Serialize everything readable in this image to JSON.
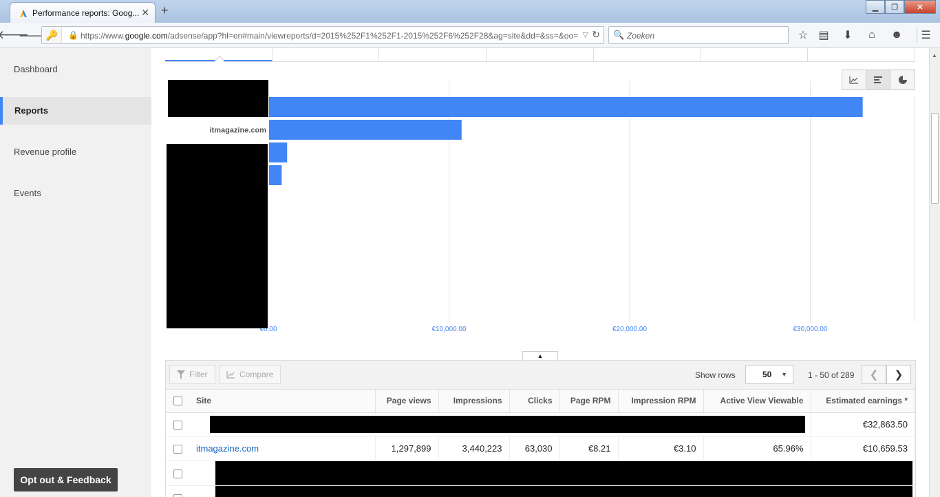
{
  "browser": {
    "tab_title": "Performance reports: Goog...",
    "url_prefix": "https://www.",
    "url_domain": "google.com",
    "url_rest": "/adsense/app?hl=en#main/viewreports/d=2015%252F1%252F1-2015%252F6%252F28&ag=site&dd=&ss=&oo=",
    "search_placeholder": "Zoeken"
  },
  "sidebar": {
    "items": [
      {
        "label": "Dashboard"
      },
      {
        "label": "Reports"
      },
      {
        "label": "Revenue profile"
      },
      {
        "label": "Events"
      }
    ],
    "feedback_label": "Opt out & Feedback"
  },
  "chart_data": {
    "type": "bar",
    "orientation": "horizontal",
    "categories": [
      "",
      "itmagazine.com",
      "",
      ""
    ],
    "values": [
      32863.5,
      10659.53,
      1000,
      700
    ],
    "xlim": [
      0,
      36000
    ],
    "x_ticks": [
      "€0.00",
      "€10,000.00",
      "€20,000.00",
      "€30,000.00"
    ],
    "x_tick_values": [
      0,
      10000,
      20000,
      30000
    ],
    "grid": true,
    "bar_color": "#4285f4"
  },
  "toolbar": {
    "filter_label": "Filter",
    "compare_label": "Compare",
    "show_rows_label": "Show rows",
    "rows_value": "50",
    "pager_text": "1 - 50 of 289"
  },
  "table": {
    "columns": [
      "Site",
      "Page views",
      "Impressions",
      "Clicks",
      "Page RPM",
      "Impression RPM",
      "Active View Viewable",
      "Estimated earnings *"
    ],
    "rows": [
      {
        "site": "",
        "earnings": "€32,863.50"
      },
      {
        "site": "itmagazine.com",
        "page_views": "1,297,899",
        "impressions": "3,440,223",
        "clicks": "63,030",
        "page_rpm": "€8.21",
        "impression_rpm": "€3.10",
        "active_view": "65.96%",
        "earnings": "€10,659.53"
      }
    ]
  }
}
